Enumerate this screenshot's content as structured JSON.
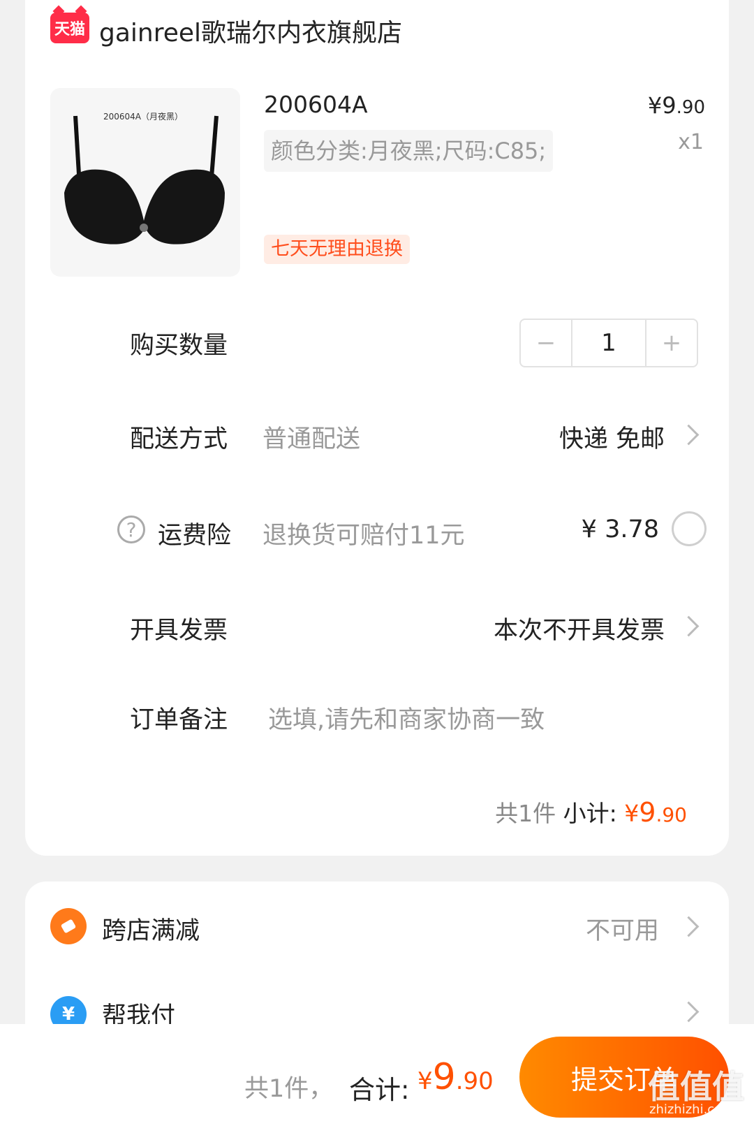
{
  "store": {
    "badge": "天猫",
    "name": "gainreel歌瑞尔内衣旗舰店"
  },
  "product": {
    "image_caption": "200604A（月夜黑）",
    "title": "200604A",
    "sku": "颜色分类:月夜黑;尺码:C85;",
    "price_symbol": "¥",
    "price_int": "9",
    "price_dec": ".90",
    "quantity_text": "x1",
    "return_badge": "七天无理由退换"
  },
  "rows": {
    "quantity_label": "购买数量",
    "quantity_value": "1",
    "minus": "−",
    "plus": "+",
    "delivery_label": "配送方式",
    "delivery_hint": "普通配送",
    "delivery_value": "快递 免邮",
    "insurance_icon": "?",
    "insurance_label": "运费险",
    "insurance_hint": "退换货可赔付11元",
    "insurance_price": "¥ 3.78",
    "invoice_label": "开具发票",
    "invoice_value": "本次不开具发票",
    "note_label": "订单备注",
    "note_placeholder": "选填,请先和商家协商一致"
  },
  "subtotal": {
    "count": "共1件",
    "label": "小计:",
    "symbol": "¥",
    "int": "9",
    "dec": ".90"
  },
  "promos": {
    "cross_store_label": "跨店满减",
    "cross_store_value": "不可用",
    "pay_for_me_label": "帮我付",
    "pay_icon": "¥"
  },
  "bottom": {
    "count": "共1件，",
    "total_label": "合计:",
    "symbol": "¥",
    "int": "9",
    "dec": ".90",
    "submit": "提交订单"
  },
  "watermark": {
    "text": "值值值",
    "sub": "zhizhizhi.com"
  },
  "colors": {
    "accent": "#ff5000",
    "tmall": "#ff2d48",
    "return_badge_bg": "#ffece4"
  }
}
